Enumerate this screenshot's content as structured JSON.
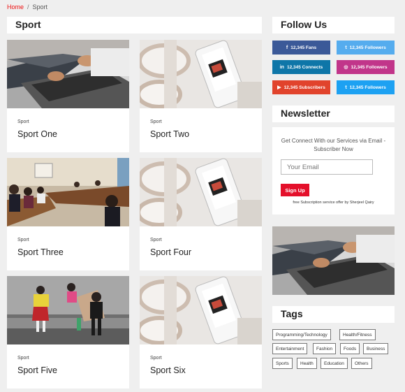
{
  "breadcrumb": {
    "home": "Home",
    "separator": "/",
    "current": "Sport"
  },
  "page_title": "Sport",
  "posts": [
    {
      "category": "Sport",
      "title": "Sport One",
      "image": "laptop-hands"
    },
    {
      "category": "Sport",
      "title": "Sport Two",
      "image": "headphones-phone"
    },
    {
      "category": "Sport",
      "title": "Sport Three",
      "image": "conference-room"
    },
    {
      "category": "Sport",
      "title": "Sport Four",
      "image": "headphones-phone"
    },
    {
      "category": "Sport",
      "title": "Sport Five",
      "image": "kids-street"
    },
    {
      "category": "Sport",
      "title": "Sport Six",
      "image": "headphones-phone"
    }
  ],
  "sidebar": {
    "follow_title": "Follow Us",
    "social": [
      {
        "label": "12,345 Fans",
        "icon": "facebook-icon",
        "glyph": "f",
        "color": "#3b5998"
      },
      {
        "label": "12,345 Followers",
        "icon": "twitter-icon",
        "glyph": "t",
        "color": "#55acee"
      },
      {
        "label": "12,345 Connects",
        "icon": "linkedin-icon",
        "glyph": "in",
        "color": "#0e76a8"
      },
      {
        "label": "12,345 Followers",
        "icon": "instagram-icon",
        "glyph": "◎",
        "color": "#c1358a"
      },
      {
        "label": "12,345 Subscribers",
        "icon": "youtube-icon",
        "glyph": "▶",
        "color": "#e1432c"
      },
      {
        "label": "12,345 Followers",
        "icon": "twitter-icon",
        "glyph": "t",
        "color": "#1da1f2"
      }
    ],
    "newsletter_title": "Newsletter",
    "newsletter_text": "Get Connect With our Services via Email - Subscriber Now",
    "email_placeholder": "Your Email",
    "signup_label": "Sign Up",
    "newsletter_note": "free Subscription service offer by Sherjeel Qairy",
    "tags_title": "Tags",
    "tags": [
      "Programming/Technology",
      "Health/Fitness",
      "Entertainment",
      "Fashion",
      "Foods",
      "Business",
      "Sports",
      "Health",
      "Education",
      "Others"
    ]
  }
}
